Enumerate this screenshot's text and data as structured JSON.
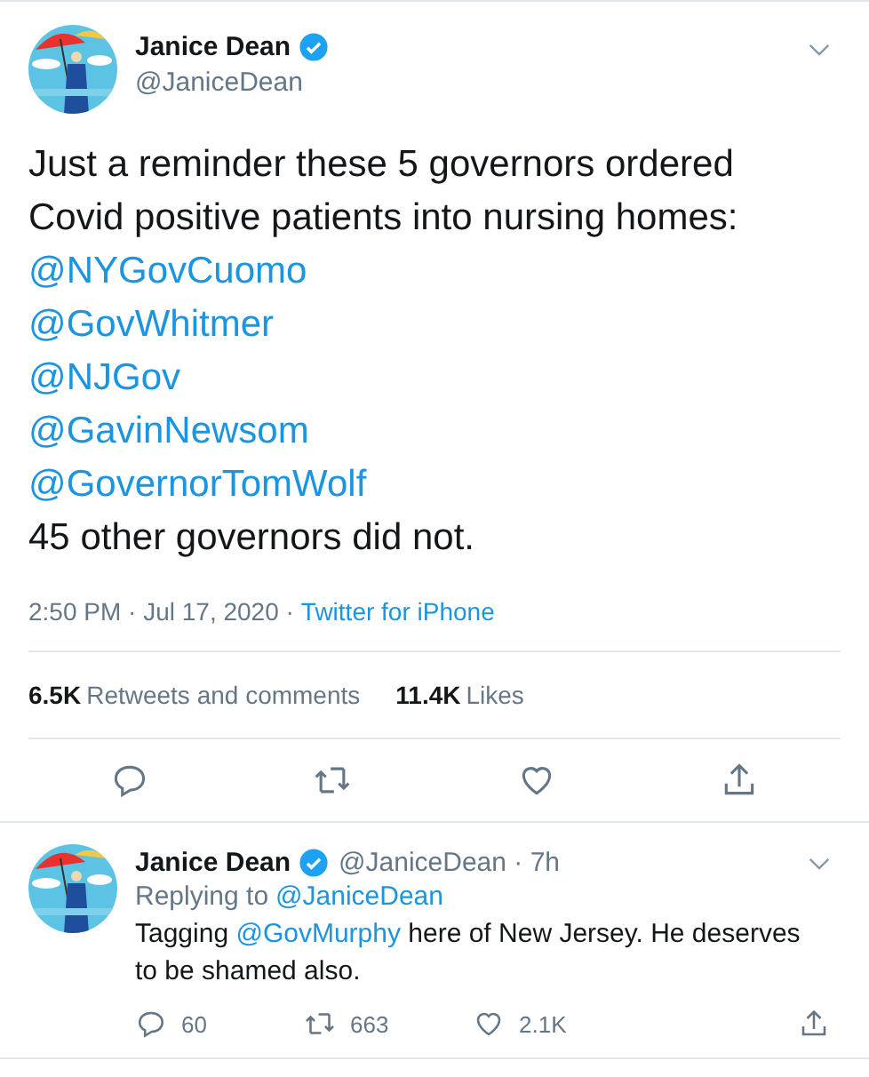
{
  "tweet": {
    "name": "Janice Dean",
    "verified": true,
    "handle": "@JaniceDean",
    "body": [
      {
        "kind": "text",
        "text": "Just a reminder these 5 governors ordered Covid positive patients into nursing homes:"
      },
      {
        "kind": "mention",
        "text": "@NYGovCuomo"
      },
      {
        "kind": "mention",
        "text": "@GovWhitmer"
      },
      {
        "kind": "mention",
        "text": "@NJGov"
      },
      {
        "kind": "mention",
        "text": "@GavinNewsom"
      },
      {
        "kind": "mention",
        "text": "@GovernorTomWolf"
      },
      {
        "kind": "text",
        "text": "45 other governors did not."
      }
    ],
    "time": "2:50 PM · Jul 17, 2020 ·",
    "source": "Twitter for iPhone",
    "stats": [
      {
        "count": "6.5K",
        "label": "Retweets and comments"
      },
      {
        "count": "11.4K",
        "label": "Likes"
      }
    ],
    "actions": [
      {
        "kind": "reply"
      },
      {
        "kind": "retweet"
      },
      {
        "kind": "like"
      },
      {
        "kind": "share"
      }
    ]
  },
  "reply": {
    "name": "Janice Dean",
    "verified": true,
    "handle": "@JaniceDean · 7h",
    "replying_to": "Replying to",
    "replying_handle": "@JaniceDean",
    "text": [
      {
        "kind": "text",
        "text": "Tagging "
      },
      {
        "kind": "mention",
        "text": "@GovMurphy"
      },
      {
        "kind": "text",
        "text": " here of New Jersey. He deserves to be shamed also."
      }
    ],
    "actions": [
      {
        "kind": "reply",
        "count": "60"
      },
      {
        "kind": "retweet",
        "count": "663"
      },
      {
        "kind": "like",
        "count": "2.1K"
      },
      {
        "kind": "share"
      }
    ]
  }
}
